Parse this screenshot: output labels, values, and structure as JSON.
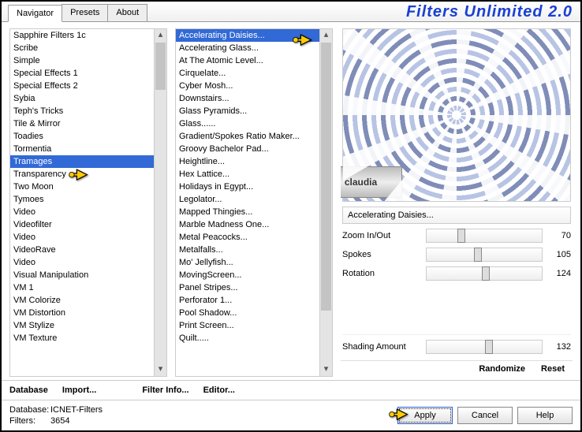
{
  "app": {
    "title": "Filters Unlimited 2.0"
  },
  "tabs": [
    {
      "label": "Navigator",
      "active": true
    },
    {
      "label": "Presets",
      "active": false
    },
    {
      "label": "About",
      "active": false
    }
  ],
  "list1": {
    "selected": "Tramages",
    "items": [
      "Sapphire Filters 1c",
      "Scribe",
      "Simple",
      "Special Effects 1",
      "Special Effects 2",
      "Sybia",
      "Teph's Tricks",
      "Tile & Mirror",
      "Toadies",
      "Tormentia",
      "Tramages",
      "Transparency",
      "Two Moon",
      "Tymoes",
      "Video",
      "Videofilter",
      "Video",
      "VideoRave",
      "Video",
      "Visual Manipulation",
      "VM 1",
      "VM Colorize",
      "VM Distortion",
      "VM Stylize",
      "VM Texture"
    ]
  },
  "list2": {
    "selected": "Accelerating Daisies...",
    "items": [
      "Accelerating Daisies...",
      "Accelerating Glass...",
      "At The Atomic Level...",
      "Cirquelate...",
      "Cyber Mosh...",
      "Downstairs...",
      "Glass Pyramids...",
      "Glass......",
      "Gradient/Spokes Ratio Maker...",
      "Groovy Bachelor Pad...",
      "Heightline...",
      "Hex Lattice...",
      "Holidays in Egypt...",
      "Legolator...",
      "Mapped Thingies...",
      "Marble Madness One...",
      "Metal Peacocks...",
      "Metalfalls...",
      "Mo' Jellyfish...",
      "MovingScreen...",
      "Panel Stripes...",
      "Perforator 1...",
      "Pool Shadow...",
      "Print Screen...",
      "Quilt....."
    ]
  },
  "filter_label": "Accelerating Daisies...",
  "sliders": [
    {
      "label": "Zoom In/Out",
      "value": 70,
      "pos": 27
    },
    {
      "label": "Spokes",
      "value": 105,
      "pos": 41
    },
    {
      "label": "Rotation",
      "value": 124,
      "pos": 48
    }
  ],
  "slider2": {
    "label": "Shading Amount",
    "value": 132,
    "pos": 51
  },
  "actions": {
    "randomize": "Randomize",
    "reset": "Reset"
  },
  "btnrow": {
    "database": "Database",
    "import": "Import...",
    "filterinfo": "Filter Info...",
    "editor": "Editor..."
  },
  "footer": {
    "db_lab": "Database:",
    "db_val": "ICNET-Filters",
    "flt_lab": "Filters:",
    "flt_val": "3654",
    "apply": "Apply",
    "cancel": "Cancel",
    "help": "Help"
  },
  "watermark": "claudia"
}
